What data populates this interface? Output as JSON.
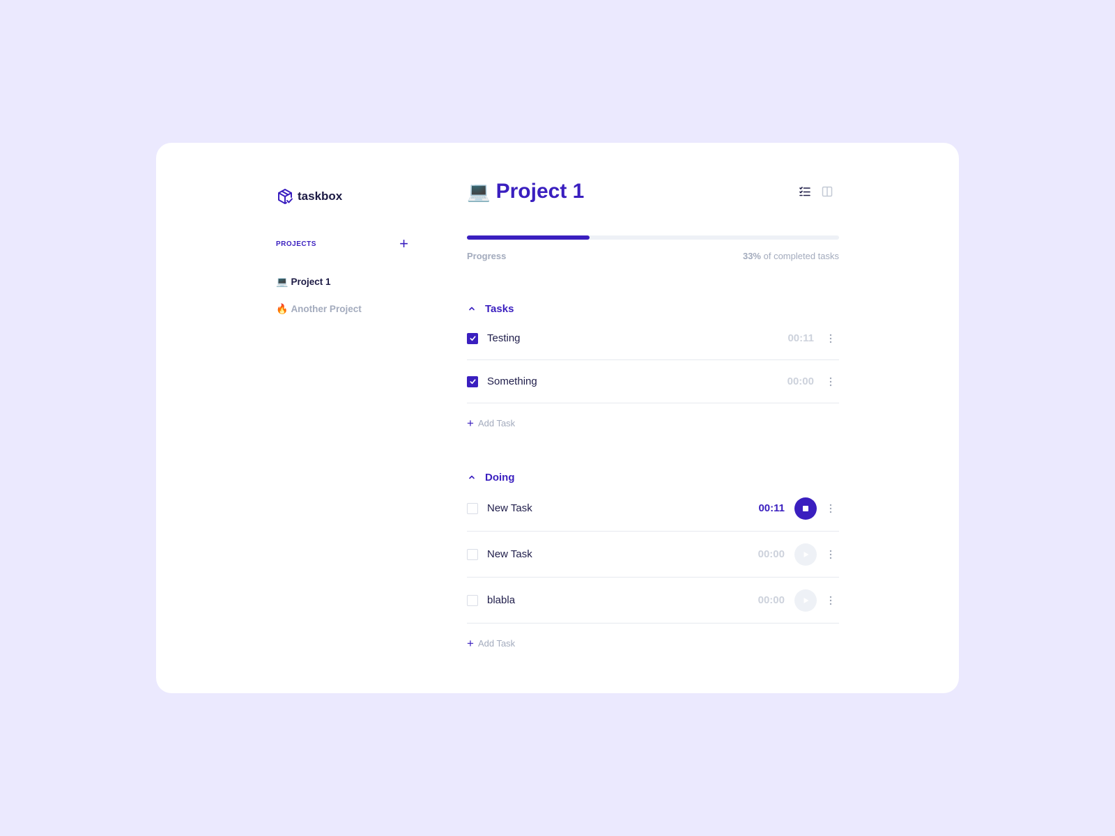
{
  "app": {
    "name": "taskbox"
  },
  "sidebar": {
    "projects_label": "PROJECTS",
    "add_project_symbol": "+",
    "projects": [
      {
        "emoji": "💻",
        "label": "Project 1",
        "active": true
      },
      {
        "emoji": "🔥",
        "label": "Another Project",
        "active": false
      }
    ]
  },
  "header": {
    "emoji": "💻",
    "title": "Project 1",
    "view_icons": [
      "list-view-icon",
      "board-view-icon"
    ]
  },
  "progress": {
    "label": "Progress",
    "percent": 33,
    "percent_text": "33%",
    "suffix": " of completed tasks"
  },
  "sections": [
    {
      "title": "Tasks",
      "tasks": [
        {
          "name": "Testing",
          "time": "00:11",
          "checked": true
        },
        {
          "name": "Something",
          "time": "00:00",
          "checked": true
        }
      ],
      "add_label": "Add Task"
    },
    {
      "title": "Doing",
      "tasks": [
        {
          "name": "New Task",
          "time": "00:11",
          "checked": false,
          "running": true
        },
        {
          "name": "New Task",
          "time": "00:00",
          "checked": false,
          "running": false
        },
        {
          "name": "blabla",
          "time": "00:00",
          "checked": false,
          "running": false
        }
      ],
      "add_label": "Add Task"
    }
  ],
  "colors": {
    "accent": "#3a1fbf",
    "background": "#ebe9fe",
    "muted": "#a3abbd",
    "card": "#ffffff"
  }
}
